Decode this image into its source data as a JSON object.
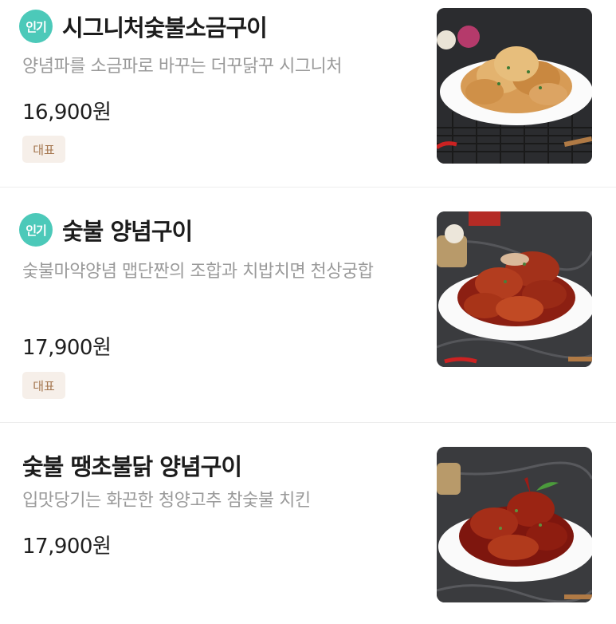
{
  "items": [
    {
      "popular_badge": "인기",
      "name": "시그니처숯불소금구이",
      "description": "양념파를 소금파로 바꾸는 더꾸닭꾸 시그니처",
      "price": "16,900원",
      "tag": "대표",
      "image_icon": "salt-grilled-chicken-photo"
    },
    {
      "popular_badge": "인기",
      "name": "숯불 양념구이",
      "description": "숯불마약양념 맵단짠의 조합과 치밥치면 천상궁합",
      "price": "17,900원",
      "tag": "대표",
      "image_icon": "sauce-grilled-chicken-photo"
    },
    {
      "name": "숯불 땡초불닭 양념구이",
      "description": "입맛당기는 화끈한 청양고추 참숯불 치킨",
      "price": "17,900원",
      "image_icon": "spicy-grilled-chicken-photo"
    }
  ],
  "colors": {
    "popular_badge": "#4cc9b9",
    "tag_bg": "#f6efe9",
    "tag_text": "#a4754d",
    "description": "#9a9a9a"
  }
}
